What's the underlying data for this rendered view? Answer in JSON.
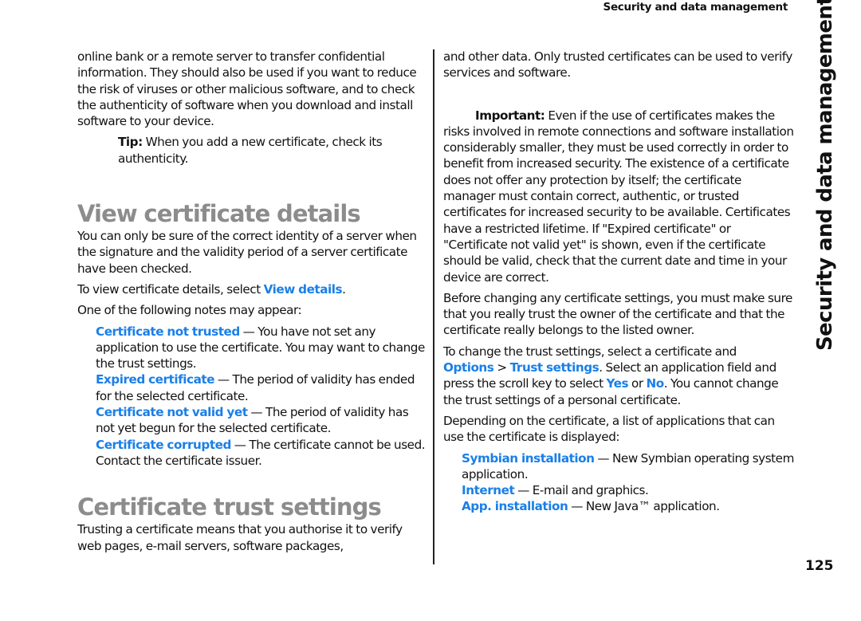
{
  "header": {
    "running_title": "Security and data management"
  },
  "side_tab": {
    "label": "Security and data management"
  },
  "page_number": "125",
  "colors": {
    "link": "#1a7fe8",
    "heading": "#8c8c8c",
    "text": "#111111"
  },
  "left_column": {
    "intro": "online bank or a remote server to transfer confidential information. They should also be used if you want to reduce the risk of viruses or other malicious software, and to check the authenticity of software when you download and install software to your device.",
    "tip": {
      "label": "Tip:",
      "text": " When you add a new certificate, check its authenticity."
    },
    "view_section": {
      "heading": "View certificate details",
      "para1": "You can only be sure of the correct identity of a server when the signature and the validity period of a server certificate have been checked.",
      "para2_prefix": "To view certificate details, select ",
      "para2_link": "View details",
      "para2_suffix": ".",
      "para3": "One of the following notes may appear:",
      "notes": [
        {
          "term": "Certificate not trusted",
          "desc": " — You have not set any application to use the certificate. You may want to change the trust settings."
        },
        {
          "term": "Expired certificate",
          "desc": " — The period of validity has ended for the selected certificate."
        },
        {
          "term": "Certificate not valid yet",
          "desc": " — The period of validity has not yet begun for the selected certificate."
        },
        {
          "term": "Certificate corrupted",
          "desc": " — The certificate cannot be used. Contact the certificate issuer."
        }
      ]
    },
    "trust_section": {
      "heading": "Certificate trust settings",
      "para1": "Trusting a certificate means that you authorise it to verify web pages, e-mail servers, software packages,"
    }
  },
  "right_column": {
    "continuation": "and other data. Only trusted certificates can be used to verify services and software.",
    "important": {
      "label": "Important:",
      "text": " Even if the use of certificates makes the risks involved in remote connections and software installation considerably smaller, they must be used correctly in order to benefit from increased security. The existence of a certificate does not offer any protection by itself; the certificate manager must contain correct, authentic, or trusted certificates for increased security to be available. Certificates have a restricted lifetime. If \"Expired certificate\" or \"Certificate not valid yet\" is shown, even if the certificate should be valid, check that the current date and time in your device are correct."
    },
    "before_changing": "Before changing any certificate settings, you must make sure that you really trust the owner of the certificate and that the certificate really belongs to the listed owner.",
    "change_trust": {
      "prefix": "To change the trust settings, select a certificate and ",
      "link1": "Options",
      "sep": ">",
      "link2": "Trust settings",
      "mid": ". Select an application field and press the scroll key to select ",
      "link_yes": "Yes",
      "or": " or ",
      "link_no": "No",
      "suffix": ". You cannot change the trust settings of a personal certificate."
    },
    "depending": "Depending on the certificate, a list of applications that can use the certificate is displayed:",
    "apps": [
      {
        "term": "Symbian installation",
        "desc": " — New Symbian operating system application."
      },
      {
        "term": "Internet",
        "desc": " — E-mail and graphics."
      },
      {
        "term": "App. installation",
        "desc": " — New Java™ application."
      }
    ]
  }
}
